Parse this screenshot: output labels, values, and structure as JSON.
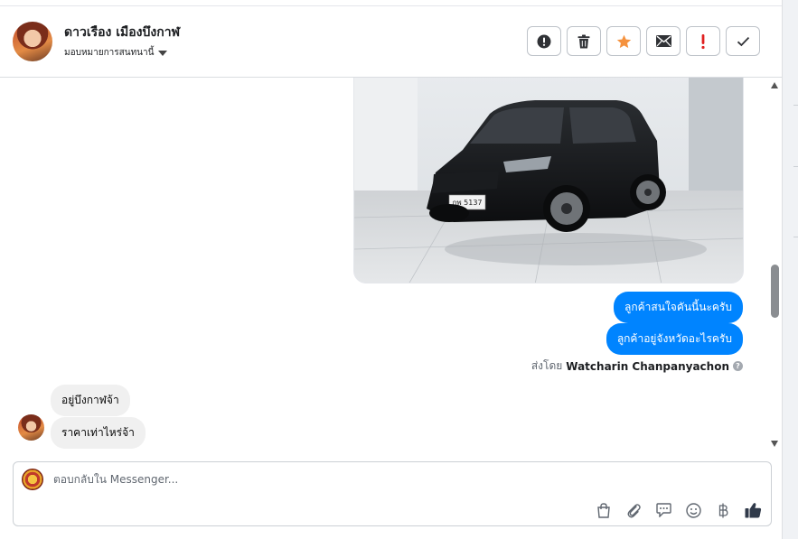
{
  "header": {
    "contact_name": "ดาวเรือง เมืองบึงกาฬ",
    "assign_label": "มอบหมายการสนทนานี้",
    "actions": [
      "spam-icon",
      "trash-icon",
      "star-icon",
      "envelope-icon",
      "exclamation-icon",
      "check-icon"
    ]
  },
  "thread": {
    "outgoing": [
      "ลูกค้าสนใจคันนี้นะครับ",
      "ลูกค้าอยู่จังหวัดอะไรครับ"
    ],
    "sent_by_prefix": "ส่งโดย",
    "sent_by_name": "Watcharin Chanpanyachon",
    "help": "?",
    "incoming": [
      "อยู่บึงกาฬจ้า",
      "ราคาเท่าไหร่จ้า"
    ],
    "photo": {
      "plate": "กพ 5137"
    }
  },
  "composer": {
    "placeholder": "ตอบกลับใน Messenger...",
    "tools": [
      "shopping-bag-icon",
      "paperclip-icon",
      "chat-bubble-icon",
      "emoji-icon",
      "baht-icon",
      "thumbs-up-icon"
    ]
  },
  "colors": {
    "accent": "#0084ff",
    "star": "#f5923e",
    "alert": "#e02020"
  }
}
